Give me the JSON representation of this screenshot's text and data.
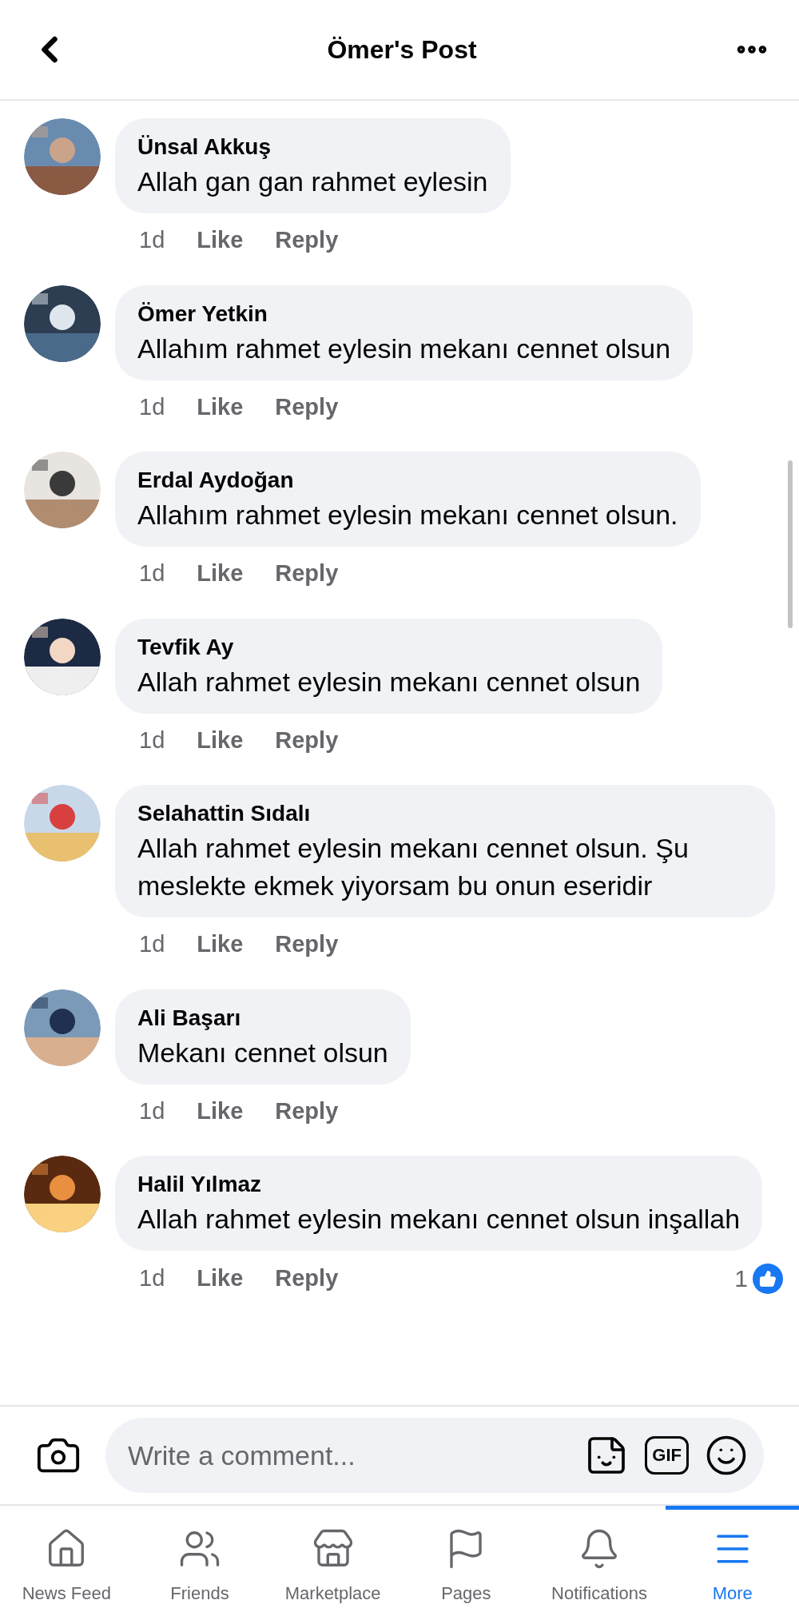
{
  "header": {
    "title": "Ömer's Post"
  },
  "comments": [
    {
      "author": "Ünsal Akkuş",
      "text": "Allah gan gan rahmet eylesin",
      "time": "1d",
      "actions": [
        "Like",
        "Reply"
      ]
    },
    {
      "author": "Ömer Yetkin",
      "text": "Allahım rahmet eylesin mekanı cennet olsun",
      "time": "1d",
      "actions": [
        "Like",
        "Reply"
      ]
    },
    {
      "author": "Erdal Aydoğan",
      "text": "Allahım rahmet eylesin mekanı cennet olsun.",
      "time": "1d",
      "actions": [
        "Like",
        "Reply"
      ]
    },
    {
      "author": "Tevfik Ay",
      "text": "Allah rahmet eylesin mekanı cennet olsun",
      "time": "1d",
      "actions": [
        "Like",
        "Reply"
      ]
    },
    {
      "author": "Selahattin Sıdalı",
      "text": "Allah rahmet eylesin mekanı cennet olsun. Şu meslekte ekmek yiyorsam bu onun eseridir",
      "time": "1d",
      "actions": [
        "Like",
        "Reply"
      ]
    },
    {
      "author": "Ali Başarı",
      "text": "Mekanı cennet olsun",
      "time": "1d",
      "actions": [
        "Like",
        "Reply"
      ]
    },
    {
      "author": "Halil Yılmaz",
      "text": "Allah rahmet eylesin mekanı cennet olsun inşallah",
      "time": "1d",
      "actions": [
        "Like",
        "Reply"
      ],
      "reaction_count": "1"
    }
  ],
  "composer": {
    "placeholder": "Write a comment...",
    "gif_label": "GIF"
  },
  "nav": [
    {
      "kind": "home",
      "label": "News Feed",
      "selected": false
    },
    {
      "kind": "friends",
      "label": "Friends",
      "selected": false
    },
    {
      "kind": "marketplace",
      "label": "Marketplace",
      "selected": false
    },
    {
      "kind": "pages",
      "label": "Pages",
      "selected": false
    },
    {
      "kind": "notifications",
      "label": "Notifications",
      "selected": false
    },
    {
      "kind": "more",
      "label": "More",
      "selected": true
    }
  ]
}
